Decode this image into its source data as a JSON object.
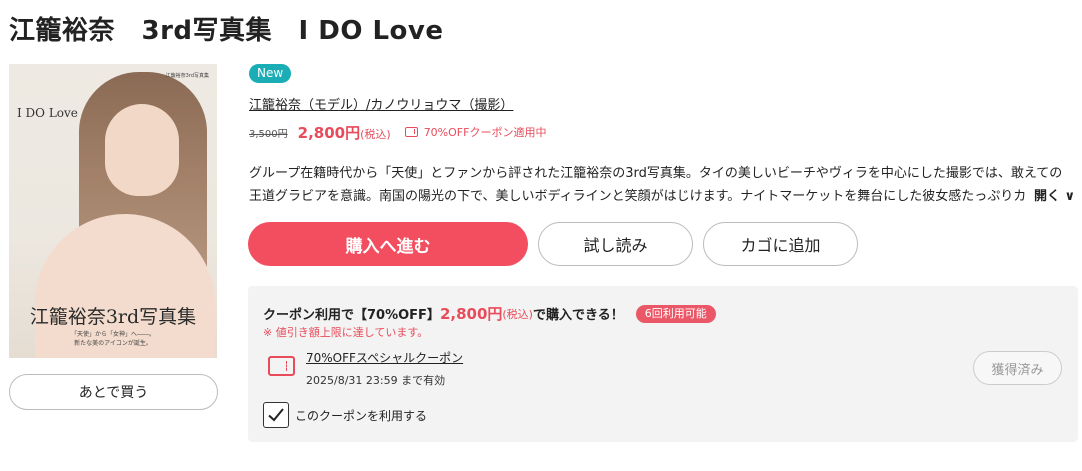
{
  "product": {
    "title": "江籠裕奈　3rd写真集　I DO Love",
    "badge": "New",
    "authors": "江籠裕奈（モデル）/カノウリョウマ（撮影）",
    "original_price": "3,500円",
    "sale_price": "2,800円",
    "tax_label": "(税込)",
    "coupon_applied": "70%OFFクーポン適用中",
    "description": "グループ在籍時代から「天使」とファンから評された江籠裕奈の3rd写真集。タイの美しいビーチやヴィラを中心にした撮影では、敢えての王道グラビアを意識。南国の陽光の下で、美しいボディラインと笑顔がはじけます。ナイトマーケットを舞台にした彼女感たっぷりカット、",
    "more_label": "開く ∨"
  },
  "cover": {
    "publisher": "江籠裕奈3rd写真集",
    "logo_text": "I DO Love",
    "name_text": "江籠裕奈3rd写真集",
    "tagline_1": "「天使」から「女神」へ――。",
    "tagline_2": "新たな美のアイコンが誕生。"
  },
  "actions": {
    "buy": "購入へ進む",
    "trial": "試し読み",
    "cart": "カゴに追加",
    "later": "あとで買う"
  },
  "coupon": {
    "headline_prefix": "クーポン利用で【70%OFF】",
    "headline_price": "2,800円",
    "headline_tax": "(税込)",
    "headline_suffix": "で購入できる！",
    "uses_badge": "6回利用可能",
    "note": "※ 値引き額上限に達しています。",
    "name": "70%OFFスペシャルクーポン",
    "valid_until": "2025/8/31 23:59 まで有効",
    "acquired_label": "獲得済み",
    "use_checkbox_label": "このクーポンを利用する",
    "use_checked": true
  },
  "colors": {
    "accent": "#f24e5f",
    "badge_new": "#1aadb5",
    "price_red": "#e84c5a"
  }
}
